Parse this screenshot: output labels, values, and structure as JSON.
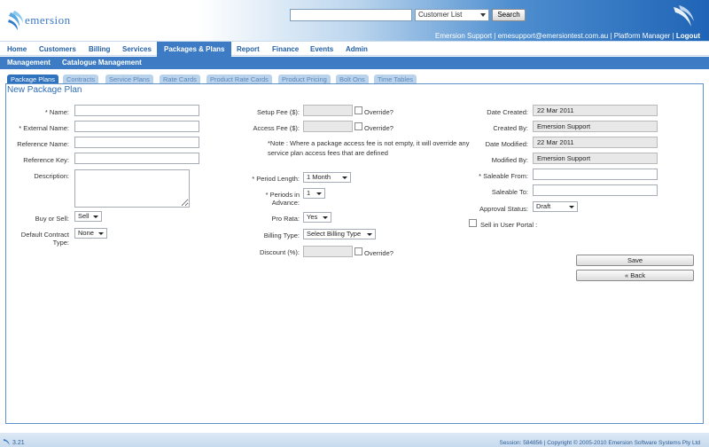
{
  "header": {
    "logo_text": "emersion",
    "search_placeholder": "",
    "search_select_value": "Customer List",
    "search_button": "Search",
    "user_name": "Emersion Support",
    "user_email": "emesupport@emersiontest.com.au",
    "platform_manager": "Platform Manager",
    "logout": "Logout"
  },
  "nav": [
    "Home",
    "Customers",
    "Billing",
    "Services",
    "Packages & Plans",
    "Report",
    "Finance",
    "Events",
    "Admin"
  ],
  "subnav": [
    "Management",
    "Catalogue Management"
  ],
  "tabs": [
    "Package Plans",
    "Contracts",
    "Service Plans",
    "Rate Cards",
    "Product Rate Cards",
    "Product Pricing",
    "Bolt Ons",
    "Time Tables"
  ],
  "form": {
    "title": "New Package Plan",
    "left": {
      "name": "* Name:",
      "external_name": "* External Name:",
      "reference_name": "Reference Name:",
      "reference_key": "Reference Key:",
      "description": "Description:",
      "buy_or_sell": "Buy or Sell:",
      "buy_or_sell_value": "Sell",
      "default_contract_type_1": "Default Contract",
      "default_contract_type_2": "Type:",
      "default_contract_type_value": "None"
    },
    "middle": {
      "setup_fee": "Setup Fee ($):",
      "access_fee": "Access Fee ($):",
      "override": "Override?",
      "note": "*Note : Where a package access fee is not empty, it will override any service plan access fees that are defined",
      "period_length": "* Period Length:",
      "period_length_value": "1 Month",
      "periods_in_advance_1": "* Periods in",
      "periods_in_advance_2": "Advance:",
      "periods_in_advance_value": "1",
      "pro_rata": "Pro Rata:",
      "pro_rata_value": "Yes",
      "billing_type": "Billing Type:",
      "billing_type_value": "Select Billing Type",
      "discount": "Discount (%):"
    },
    "right": {
      "date_created": "Date Created:",
      "date_created_value": "22 Mar 2011",
      "created_by": "Created By:",
      "created_by_value": "Emersion Support",
      "date_modified": "Date Modified:",
      "date_modified_value": "22 Mar 2011",
      "modified_by": "Modified By:",
      "modified_by_value": "Emersion Support",
      "saleable_from": "* Saleable From:",
      "saleable_to": "Saleable To:",
      "approval_status": "Approval Status:",
      "approval_status_value": "Draft",
      "sell_in_user_portal": "Sell in User Portal :"
    },
    "buttons": {
      "save": "Save",
      "back": "« Back"
    }
  },
  "footer": {
    "version": "3.21",
    "session": "Session: 584856 | Copyright © 2005-2010 Emersion Software Systems Pty Ltd"
  },
  "colors": {
    "accent": "#3d7cc4",
    "nav_text": "#2460a7",
    "panel_border": "#5e91c9"
  }
}
